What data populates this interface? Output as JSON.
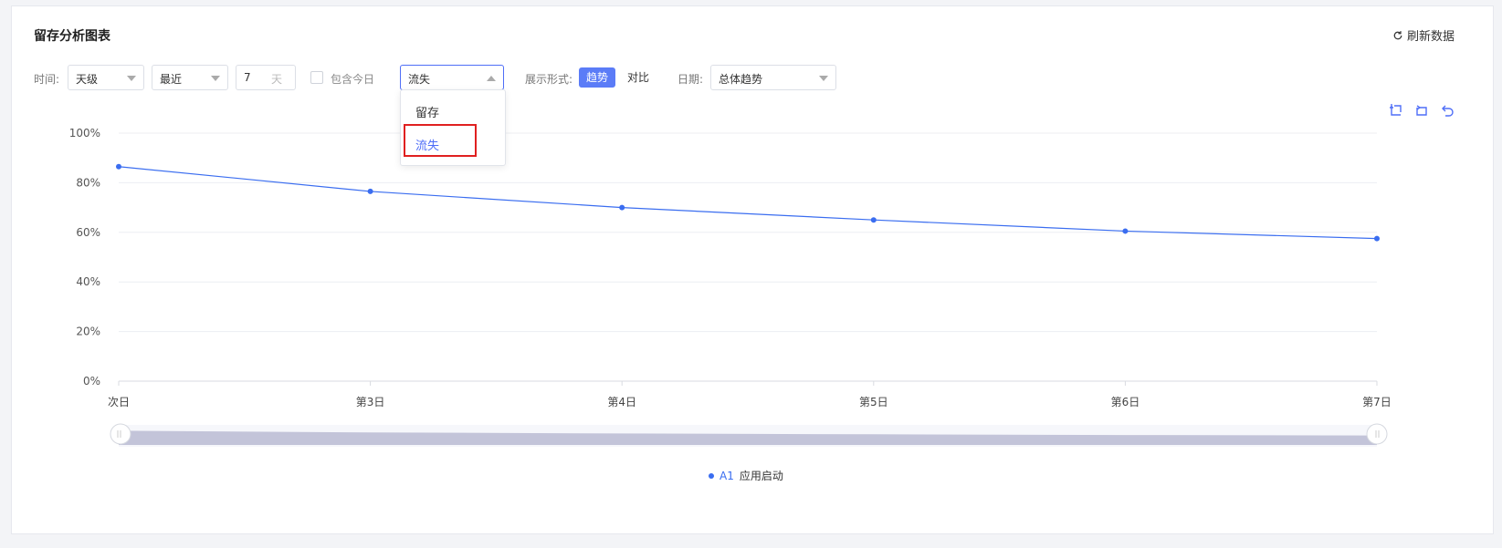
{
  "header": {
    "title": "留存分析图表",
    "refresh_label": "刷新数据"
  },
  "filters": {
    "time_label": "时间:",
    "granularity": "天级",
    "range": "最近",
    "days_value": "7",
    "days_unit": "天",
    "include_today_label": "包含今日",
    "include_today_checked": false,
    "type_select_value": "流失",
    "display_label": "展示形式:",
    "display_trend": "趋势",
    "display_compare": "对比",
    "date_label": "日期:",
    "date_value": "总体趋势"
  },
  "dropdown": {
    "options": [
      "留存",
      "流失"
    ],
    "selected": "流失"
  },
  "legend": {
    "prefix": "A1",
    "name": "应用启动"
  },
  "colors": {
    "accent": "#4f6ef7",
    "series": "#3a6df0",
    "highlight": "#e02020",
    "slider_fill": "#c3c4d9"
  },
  "chart_data": {
    "type": "line",
    "categories": [
      "次日",
      "第3日",
      "第4日",
      "第5日",
      "第6日",
      "第7日"
    ],
    "series": [
      {
        "name": "A1 应用启动",
        "values": [
          86.5,
          76.5,
          70,
          65,
          60.5,
          57.5
        ]
      }
    ],
    "y_ticks": [
      "0%",
      "20%",
      "40%",
      "60%",
      "80%",
      "100%"
    ],
    "ylim": [
      0,
      100
    ],
    "grid": true,
    "legend_position": "bottom-center"
  }
}
